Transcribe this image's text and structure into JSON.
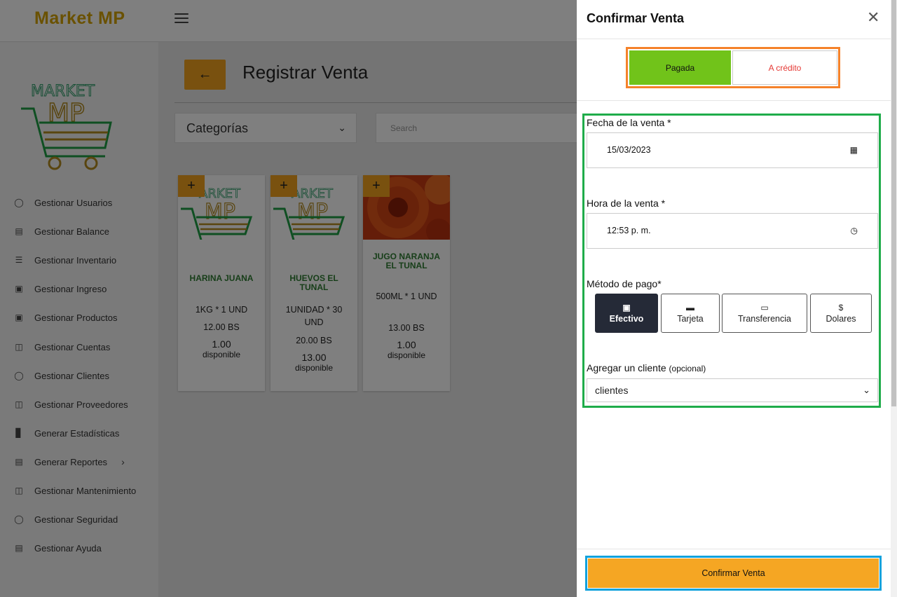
{
  "app": {
    "brand": "Market MP"
  },
  "sidebar": {
    "items": [
      {
        "label": "Gestionar Usuarios",
        "icon": "user-icon"
      },
      {
        "label": "Gestionar Balance",
        "icon": "ledger-icon"
      },
      {
        "label": "Gestionar Inventario",
        "icon": "inventory-icon"
      },
      {
        "label": "Gestionar Ingreso",
        "icon": "cart-icon"
      },
      {
        "label": "Gestionar Productos",
        "icon": "cart-icon"
      },
      {
        "label": "Gestionar Cuentas",
        "icon": "book-icon"
      },
      {
        "label": "Gestionar Clientes",
        "icon": "user-icon"
      },
      {
        "label": "Gestionar Proveedores",
        "icon": "truck-icon"
      },
      {
        "label": "Generar Estadísticas",
        "icon": "bar-chart-icon"
      },
      {
        "label": "Generar Reportes",
        "icon": "clipboard-icon"
      },
      {
        "label": "Gestionar Mantenimiento",
        "icon": "database-icon"
      },
      {
        "label": "Gestionar Seguridad",
        "icon": "shield-icon"
      },
      {
        "label": "Gestionar Ayuda",
        "icon": "open-book-icon"
      }
    ]
  },
  "main": {
    "title": "Registrar Venta",
    "category_select": "Categorías",
    "search_placeholder": "Search",
    "products": [
      {
        "name": "HARINA JUANA",
        "desc": "1KG * 1 UND",
        "price": "12.00 BS",
        "qty": "1.00",
        "avail": "disponible"
      },
      {
        "name": "HUEVOS EL TUNAL",
        "desc": "1UNIDAD * 30 UND",
        "price": "20.00 BS",
        "qty": "13.00",
        "avail": "disponible"
      },
      {
        "name": "JUGO NARANJA EL TUNAL",
        "desc": "500ML * 1 UND",
        "price": "13.00 BS",
        "qty": "1.00",
        "avail": "disponible"
      }
    ]
  },
  "modal": {
    "title": "Confirmar Venta",
    "status_paid": "Pagada",
    "status_credit": "A crédito",
    "date_label": "Fecha de la venta *",
    "date_value": "15/03/2023",
    "time_label": "Hora de la venta *",
    "time_value": "12:53  p. m.",
    "payment_label": "Método de pago*",
    "payment_methods": [
      {
        "label": "Efectivo",
        "icon": "wallet-icon"
      },
      {
        "label": "Tarjeta",
        "icon": "credit-card-icon"
      },
      {
        "label": "Transferencia",
        "icon": "monitor-icon"
      },
      {
        "label": "Dolares",
        "icon": "dollar-icon"
      }
    ],
    "selected_payment": "Efectivo",
    "client_label": "Agregar un cliente",
    "client_optional": "(opcional)",
    "client_select": "clientes",
    "confirm_button": "Confirmar Venta"
  },
  "colors": {
    "accent": "#f2a31e",
    "paid_green": "#71c31a",
    "credit_red": "#e53935",
    "dark_button": "#252a37",
    "product_green": "#2e7d32"
  }
}
